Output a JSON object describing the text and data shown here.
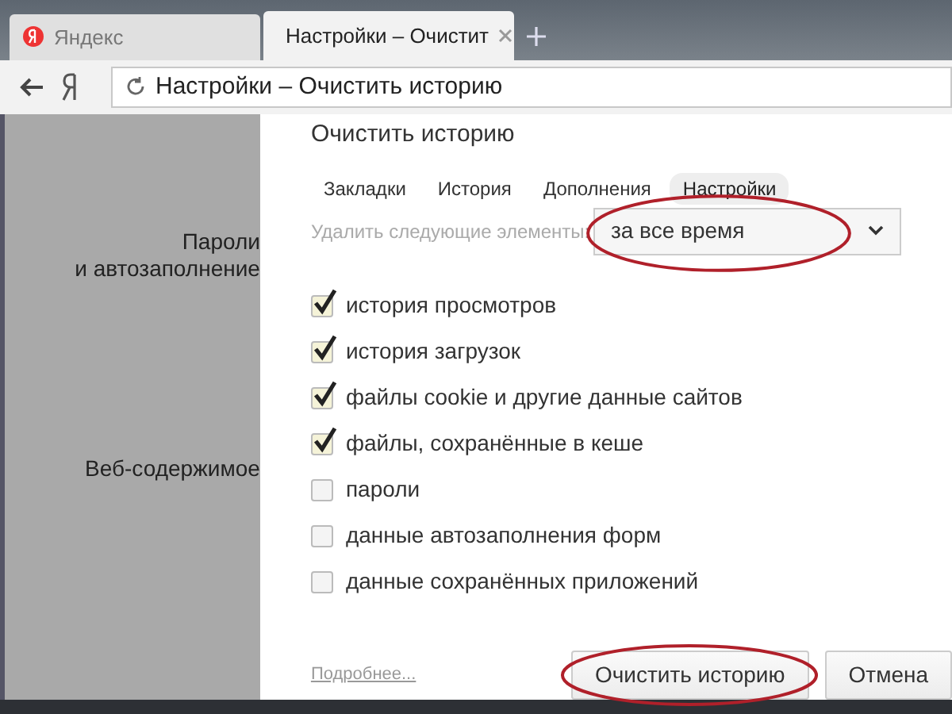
{
  "browser_tabs": [
    {
      "label": "Яндекс",
      "selected": false
    },
    {
      "label": "Настройки – Очистит",
      "selected": true
    }
  ],
  "address_bar": {
    "value": "Настройки – Очистить историю"
  },
  "background_labels": [
    {
      "lines": [
        "Пароли",
        "и автозаполнение"
      ]
    },
    {
      "lines": [
        "Веб-содержимое"
      ]
    }
  ],
  "dialog": {
    "title": "Очистить историю",
    "tabs": [
      {
        "label": "Закладки",
        "selected": false
      },
      {
        "label": "История",
        "selected": false
      },
      {
        "label": "Дополнения",
        "selected": false
      },
      {
        "label": "Настройки",
        "selected": true
      }
    ],
    "period_label": "Удалить следующие элементы:",
    "period": {
      "value": "за все время",
      "circled": true
    },
    "items": [
      {
        "label": "история просмотров",
        "checked": true
      },
      {
        "label": "история загрузок",
        "checked": true
      },
      {
        "label": "файлы cookie и другие данные сайтов",
        "checked": true
      },
      {
        "label": "файлы, сохранённые в кеше",
        "checked": true
      },
      {
        "label": "пароли",
        "checked": false
      },
      {
        "label": "данные автозаполнения форм",
        "checked": false
      },
      {
        "label": "данные сохранённых приложений",
        "checked": false
      }
    ],
    "more_link": "Подробнее...",
    "buttons": [
      {
        "label": "Очистить историю",
        "circled": true
      },
      {
        "label": "Отмена",
        "circled": false
      }
    ]
  }
}
